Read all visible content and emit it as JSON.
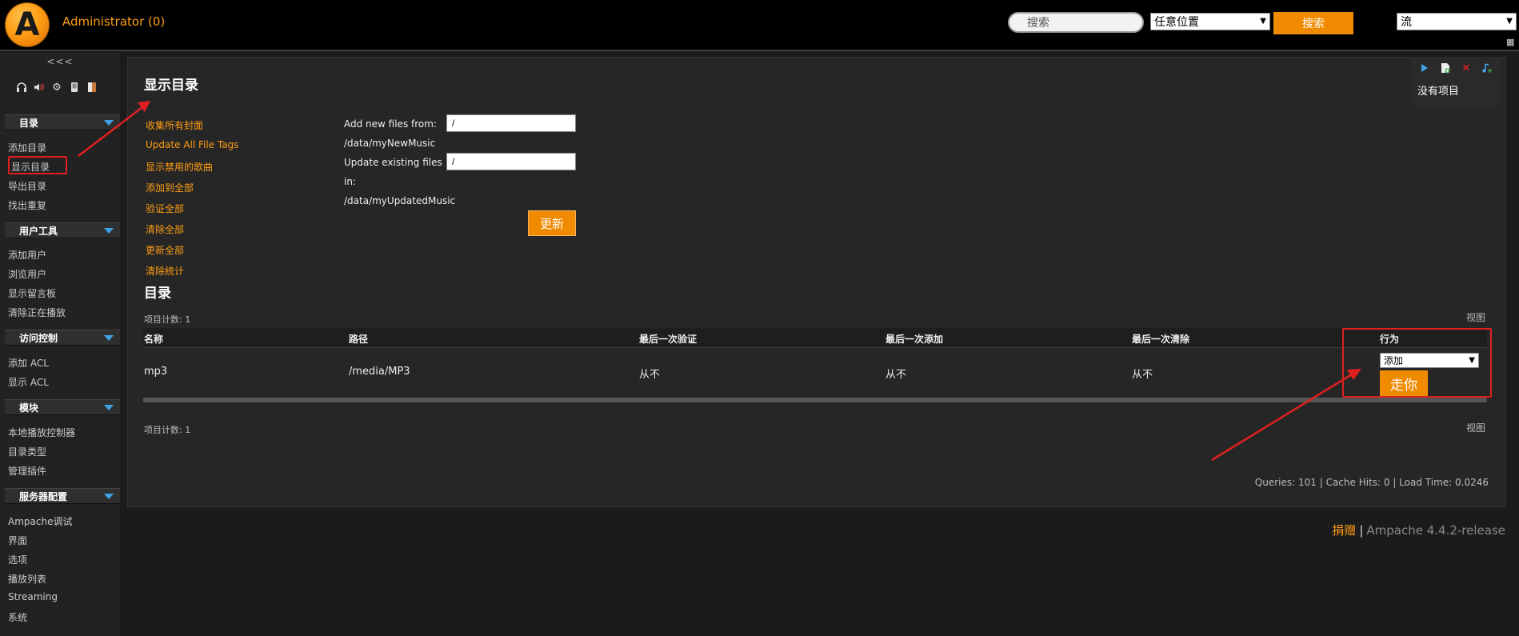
{
  "header": {
    "logo_letter": "A",
    "admin_label": "Administrator (0)",
    "search_placeholder": "搜索",
    "location_select": "任意位置",
    "search_button": "搜索",
    "stream_select": "流",
    "menu_glyph": "▦"
  },
  "sidebar": {
    "collapse_label": "<<<",
    "toolbar_icons": [
      "headphones-icon",
      "speaker-icon",
      "gear-icon",
      "device-icon",
      "door-icon"
    ],
    "sections": [
      {
        "title": "目录",
        "items": [
          "添加目录",
          "显示目录",
          "导出目录",
          "找出重复"
        ]
      },
      {
        "title": "用户工具",
        "items": [
          "添加用户",
          "浏览用户",
          "显示留言板",
          "清除正在播放"
        ]
      },
      {
        "title": "访问控制",
        "items": [
          "添加 ACL",
          "显示 ACL"
        ]
      },
      {
        "title": "模块",
        "items": [
          "本地播放控制器",
          "目录类型",
          "管理插件"
        ]
      },
      {
        "title": "服务器配置",
        "items": [
          "Ampache调试",
          "界面",
          "选项",
          "播放列表",
          "Streaming",
          "系统"
        ]
      }
    ]
  },
  "main": {
    "title": "显示目录",
    "actions": [
      "收集所有封面",
      "Update All File Tags",
      "显示禁用的歌曲",
      "添加到全部",
      "验证全部",
      "清除全部",
      "更新全部",
      "清除统计"
    ],
    "form": {
      "add_label": "Add new files from:",
      "add_path": "/data/myNewMusic",
      "add_value": "/",
      "update_label_1": "Update existing files",
      "update_label_2": "in:",
      "update_path": "/data/myUpdatedMusic",
      "update_value": "/",
      "update_button": "更新"
    },
    "catalog_title": "目录",
    "item_count": "项目计数: 1",
    "view_link": "视图",
    "table": {
      "headers": [
        "名称",
        "路径",
        "最后一次验证",
        "最后一次添加",
        "最后一次清除",
        "行为"
      ],
      "rows": [
        {
          "name": "mp3",
          "path": "/media/MP3",
          "last_verify": "从不",
          "last_add": "从不",
          "last_clean": "从不",
          "action_select": "添加",
          "go_button": "走你"
        }
      ]
    },
    "stats": "Queries: 101 | Cache Hits: 0 | Load Time: 0.0246"
  },
  "playlist_panel": {
    "empty_text": "没有项目",
    "icons": [
      "play-icon",
      "add-file-icon",
      "delete-icon",
      "add-music-icon"
    ]
  },
  "footer": {
    "donate": "捐赠",
    "separator": "|",
    "version": "Ampache 4.4.2-release"
  },
  "colors": {
    "accent": "#ff9d14",
    "button": "#f08a00",
    "highlight_red": "#e02020",
    "arrow_blue": "#3fa2e8"
  }
}
